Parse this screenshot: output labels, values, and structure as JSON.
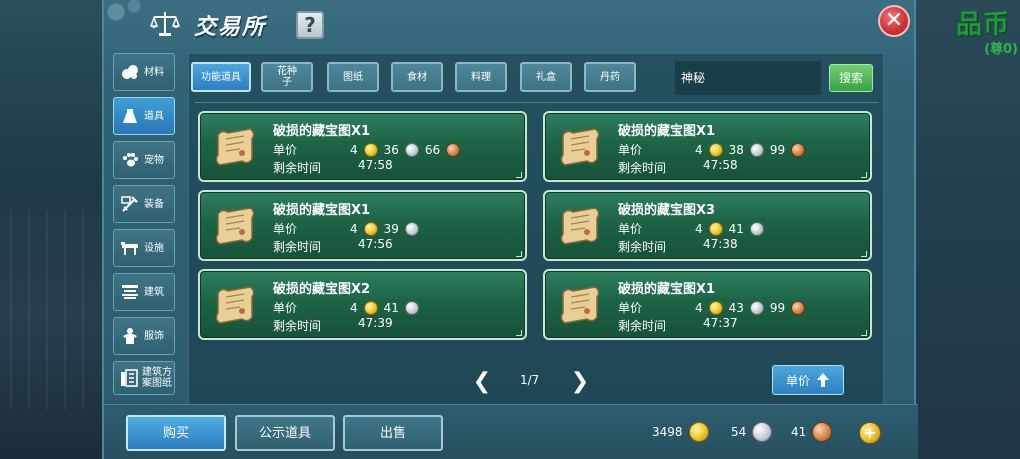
{
  "window": {
    "title": "交易所",
    "help_label": "?",
    "close_label": "✕"
  },
  "background": {
    "sign_text": "品币",
    "sign_sub": "(尊0)"
  },
  "categories": [
    {
      "label": "材料",
      "icon": "materials-icon",
      "active": false
    },
    {
      "label": "道具",
      "icon": "items-icon",
      "active": true
    },
    {
      "label": "宠物",
      "icon": "pet-paw-icon",
      "active": false
    },
    {
      "label": "装备",
      "icon": "equipment-icon",
      "active": false
    },
    {
      "label": "设施",
      "icon": "facility-icon",
      "active": false
    },
    {
      "label": "建筑",
      "icon": "building-icon",
      "active": false
    },
    {
      "label": "服饰",
      "icon": "clothing-icon",
      "active": false
    },
    {
      "label": "建筑方案图纸",
      "icon": "blueprint-icon",
      "active": false
    }
  ],
  "tabs": [
    {
      "label": "功能道具",
      "active": true
    },
    {
      "label": "花种子",
      "active": false
    },
    {
      "label": "图纸",
      "active": false
    },
    {
      "label": "食材",
      "active": false
    },
    {
      "label": "料理",
      "active": false
    },
    {
      "label": "礼盒",
      "active": false
    },
    {
      "label": "丹药",
      "active": false
    }
  ],
  "search": {
    "value": "神秘",
    "button_label": "搜索"
  },
  "labels": {
    "unit_price": "单价",
    "remaining_time": "剩余时间"
  },
  "listings": [
    {
      "name": "破损的藏宝图X1",
      "gold": "4",
      "silver": "36",
      "copper": "66",
      "time": "47:58"
    },
    {
      "name": "破损的藏宝图X1",
      "gold": "4",
      "silver": "38",
      "copper": "99",
      "time": "47:58"
    },
    {
      "name": "破损的藏宝图X1",
      "gold": "4",
      "silver": "39",
      "copper": "",
      "time": "47:56"
    },
    {
      "name": "破损的藏宝图X3",
      "gold": "4",
      "silver": "41",
      "copper": "",
      "time": "47:38"
    },
    {
      "name": "破损的藏宝图X2",
      "gold": "4",
      "silver": "41",
      "copper": "",
      "time": "47:39"
    },
    {
      "name": "破损的藏宝图X1",
      "gold": "4",
      "silver": "43",
      "copper": "99",
      "time": "47:37"
    }
  ],
  "pagination": {
    "prev": "❮",
    "next": "❯",
    "page_text": "1/7"
  },
  "sort": {
    "label": "单价"
  },
  "bottom": {
    "buy_label": "购买",
    "public_label": "公示道具",
    "sell_label": "出售"
  },
  "wallet": {
    "gold": "3498",
    "silver": "54",
    "copper": "41",
    "plus": "+"
  },
  "colors": {
    "gold_coin": "#f4cf36",
    "silver_coin": "#c9d3d9",
    "copper_coin": "#d98a4f",
    "card_green": "#1d6447",
    "active_blue": "#2d7fc0",
    "search_green": "#38a142",
    "close_red": "#d13438"
  }
}
